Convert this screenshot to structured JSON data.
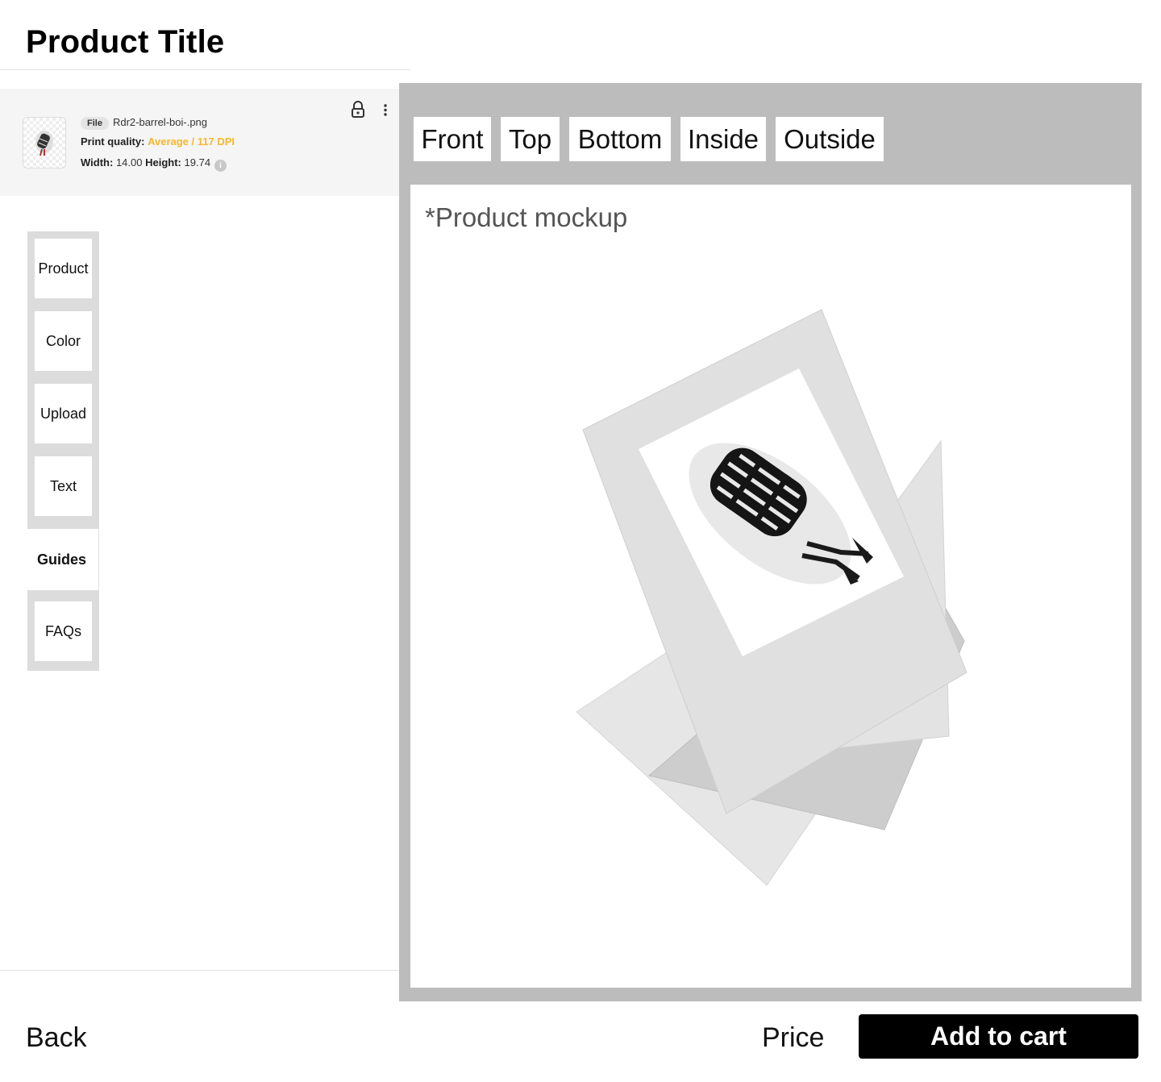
{
  "header": {
    "title": "Product Title"
  },
  "file": {
    "badge": "File",
    "name": "Rdr2-barrel-boi-.png",
    "quality_label": "Print quality:",
    "quality_value": "Average / 117 DPI",
    "quality_color": "#f5b82e",
    "width_label": "Width:",
    "width_value": "14.00",
    "height_label": "Height:",
    "height_value": "19.74",
    "icons": [
      "lock-icon",
      "more-vertical-icon",
      "info-icon"
    ]
  },
  "side_nav": {
    "items": [
      {
        "label": "Product"
      },
      {
        "label": "Color"
      },
      {
        "label": "Upload"
      },
      {
        "label": "Text"
      },
      {
        "label": "Guides",
        "active": true
      },
      {
        "label": "FAQs"
      }
    ]
  },
  "preview": {
    "tabs": [
      {
        "label": "Front"
      },
      {
        "label": "Top"
      },
      {
        "label": "Bottom"
      },
      {
        "label": "Inside"
      },
      {
        "label": "Outside"
      }
    ],
    "mockup_label": "*Product mockup"
  },
  "footer": {
    "back_label": "Back",
    "price_label": "Price",
    "add_to_cart_label": "Add to cart"
  }
}
